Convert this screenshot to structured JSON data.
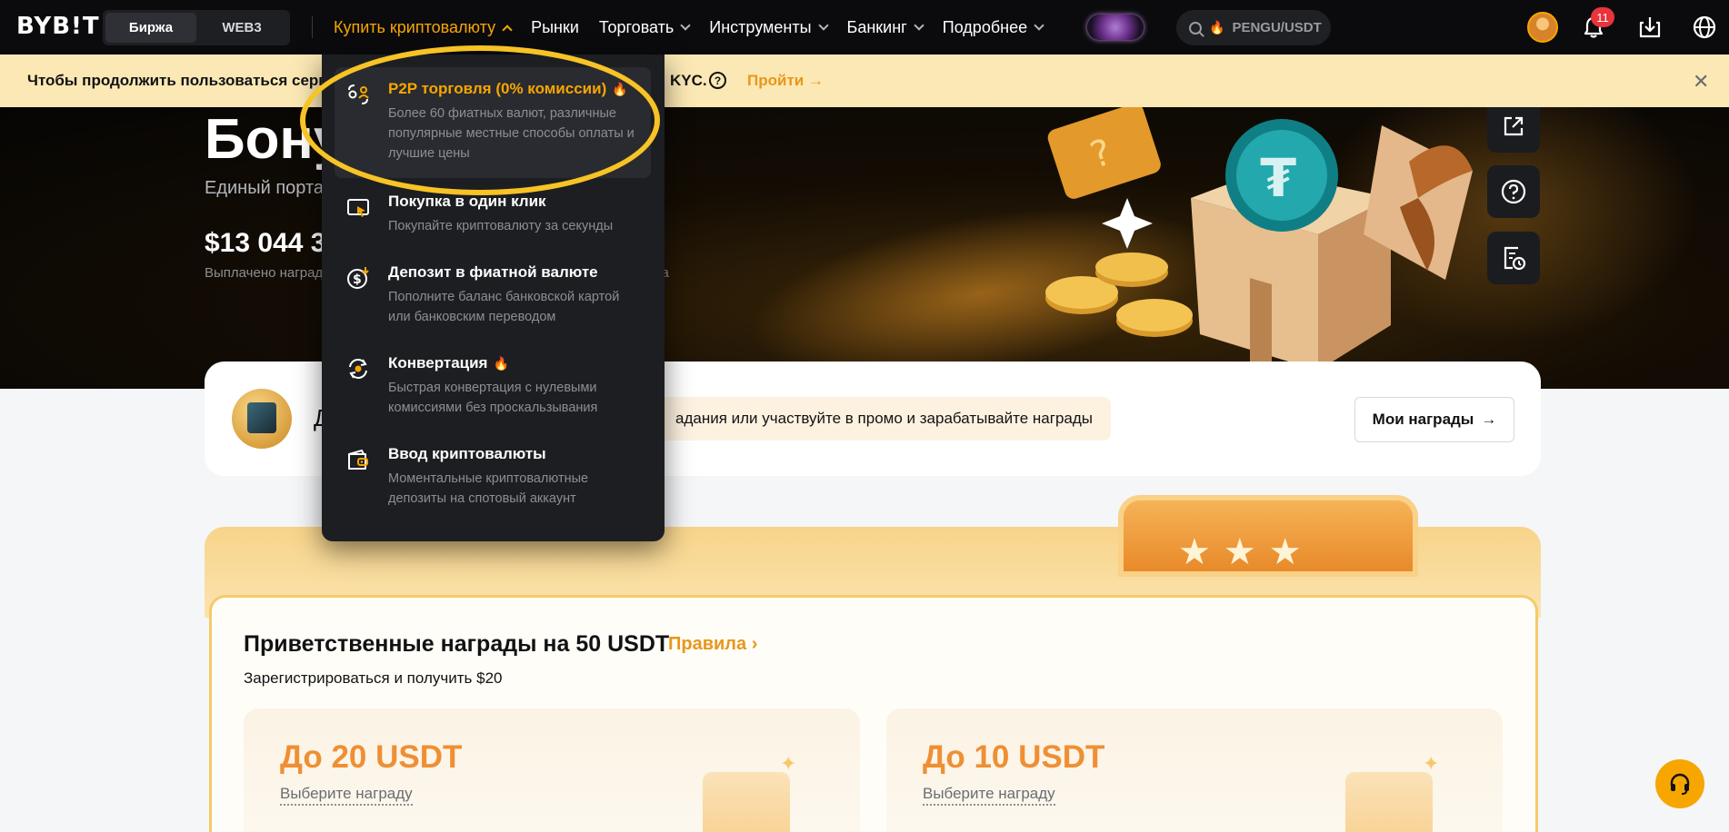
{
  "brand": {
    "logo_text": "BYB!T",
    "accent": "#f7a600"
  },
  "env_toggle": {
    "exchange": "Биржа",
    "web3": "WEB3"
  },
  "nav": {
    "items": [
      {
        "label": "Купить криптовалюту",
        "active": true
      },
      {
        "label": "Рынки"
      },
      {
        "label": "Торговать"
      },
      {
        "label": "Инструменты"
      },
      {
        "label": "Банкинг"
      },
      {
        "label": "Подробнее"
      }
    ],
    "search_value": "PENGU/USDT",
    "notifications_count": "11"
  },
  "kyc_banner": {
    "message_start": "Чтобы продолжить пользоваться серв",
    "message_end": "KYC.",
    "action": "Пройти"
  },
  "hero": {
    "title": "Бону",
    "subtitle": "Единый порта",
    "amount": "$13 044 3",
    "paid_label": "Выплачено наград",
    "paid_tail": "са"
  },
  "buy_menu": {
    "items": [
      {
        "title": "P2P торговля (0% комиссии)",
        "hot": true,
        "highlighted": true,
        "desc": "Более 60 фиатных валют, различные популярные местные способы оплаты и лучшие цены",
        "icon": "p2p-icon"
      },
      {
        "title": "Покупка в один клик",
        "hot": false,
        "desc": "Покупайте криптовалюту за секунды",
        "icon": "one-click-card-icon"
      },
      {
        "title": "Депозит в фиатной валюте",
        "hot": false,
        "desc": "Пополните баланс банковской картой или банковским переводом",
        "icon": "fiat-deposit-icon"
      },
      {
        "title": "Конвертация",
        "hot": true,
        "desc": "Быстрая конвертация с нулевыми комиссиями без проскальзывания",
        "icon": "convert-icon"
      },
      {
        "title": "Ввод криптовалюты",
        "hot": false,
        "desc": "Моментальные криптовалютные депозиты на спотовый аккаунт",
        "icon": "crypto-deposit-icon"
      }
    ]
  },
  "rewards_bar": {
    "letter": "Д",
    "text": "адания или участвуйте в промо и зарабатывайте награды",
    "my_rewards": "Мои награды"
  },
  "welcome": {
    "title": "Приветственные награды на 50 USDT",
    "rules": "Правила",
    "subtitle": "Зарегистрироваться и получить $20",
    "tiers": [
      {
        "amount": "До 20 USDT",
        "choose": "Выберите награду"
      },
      {
        "amount": "До 10 USDT",
        "choose": "Выберите награду"
      }
    ]
  },
  "fire_glyph": "🔥"
}
